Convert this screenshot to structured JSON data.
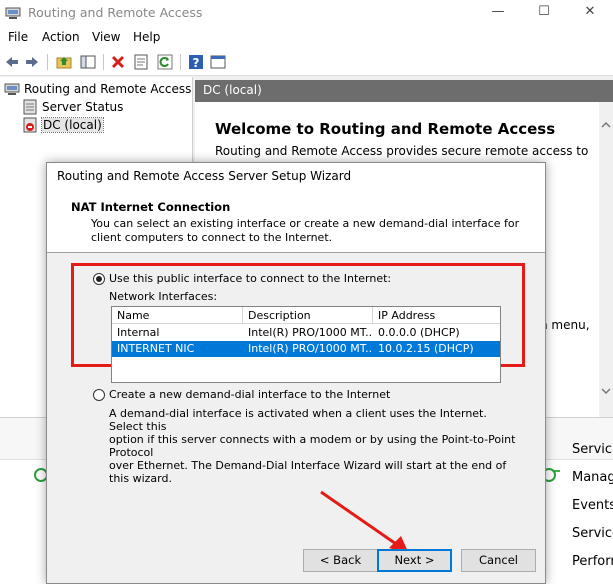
{
  "window": {
    "title": "Routing and Remote Access",
    "minimize": "—",
    "maximize": "☐",
    "close": "✕"
  },
  "menu": [
    "File",
    "Action",
    "View",
    "Help"
  ],
  "toolbar_icons": [
    "back-icon",
    "forward-icon",
    "up-folder-icon",
    "show-hide-tree-icon",
    "delete-icon",
    "properties-icon",
    "refresh-icon",
    "help-icon",
    "console-icon"
  ],
  "tree": {
    "root": "Routing and Remote Access",
    "items": [
      "Server Status",
      "DC (local)"
    ]
  },
  "right_pane": {
    "header": "DC (local)",
    "title": "Welcome to Routing and Remote Access",
    "text": "Routing and Remote Access provides secure remote access to",
    "partial_text": "n menu,"
  },
  "lower_panel": {
    "items": [
      "Servic",
      "Manag",
      "Events",
      "Service",
      "Perforr"
    ]
  },
  "dialog": {
    "title": "Routing and Remote Access Server Setup Wizard",
    "heading": "NAT Internet Connection",
    "subheading_line1": "You can select an existing interface or create a new demand-dial interface for",
    "subheading_line2": "client computers to connect to the Internet.",
    "option1": "Use this public interface to connect to the Internet:",
    "network_interfaces_label": "Network Interfaces:",
    "columns": [
      "Name",
      "Description",
      "IP Address"
    ],
    "rows": [
      {
        "name": "Internal",
        "description": "Intel(R) PRO/1000 MT...",
        "ip": "0.0.0.0 (DHCP)"
      },
      {
        "name": "INTERNET NIC",
        "description": "Intel(R) PRO/1000 MT...",
        "ip": "10.0.2.15 (DHCP)"
      }
    ],
    "option2": "Create a new demand-dial interface to the Internet",
    "option2_desc_line1": "A demand-dial interface is activated when a client uses the Internet. Select this",
    "option2_desc_line2": "option if this server connects with a modem or by using the Point-to-Point Protocol",
    "option2_desc_line3": "over Ethernet. The Demand-Dial Interface Wizard will start at the end of this wizard.",
    "back_button": "< Back",
    "next_button": "Next >",
    "cancel_button": "Cancel"
  },
  "colors": {
    "accent": "#0078d7",
    "highlight_box": "#e41b17",
    "header_bar": "#6d6d6d"
  }
}
